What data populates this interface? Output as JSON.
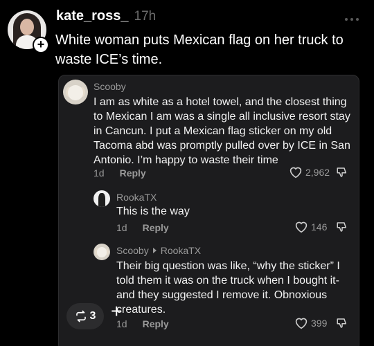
{
  "post": {
    "username": "kate_ross_",
    "time": "17h",
    "text": "White woman puts Mexican flag on her truck to waste ICE’s time."
  },
  "comments": [
    {
      "author": "Scooby",
      "text": "I am as white as a hotel towel, and the closest thing to Mexican I am was a single all inclusive resort stay in Cancun. I put a Mexican flag sticker on my old Tacoma abd was promptly pulled over by ICE in San Antonio. I’m happy to waste their time",
      "time": "1d",
      "reply_label": "Reply",
      "likes": "2,962"
    },
    {
      "author": "RookaTX",
      "text": "This is the way",
      "time": "1d",
      "reply_label": "Reply",
      "likes": "146"
    },
    {
      "author": "Scooby",
      "reply_to": "RookaTX",
      "text": "Their big question was like, “why the sticker” I told them it was on the truck when I bought it- and they suggested I remove it. Obnoxious creatures.",
      "time": "1d",
      "reply_label": "Reply",
      "likes": "399"
    }
  ],
  "actions": {
    "repost_count": "3",
    "add_label": "+"
  }
}
